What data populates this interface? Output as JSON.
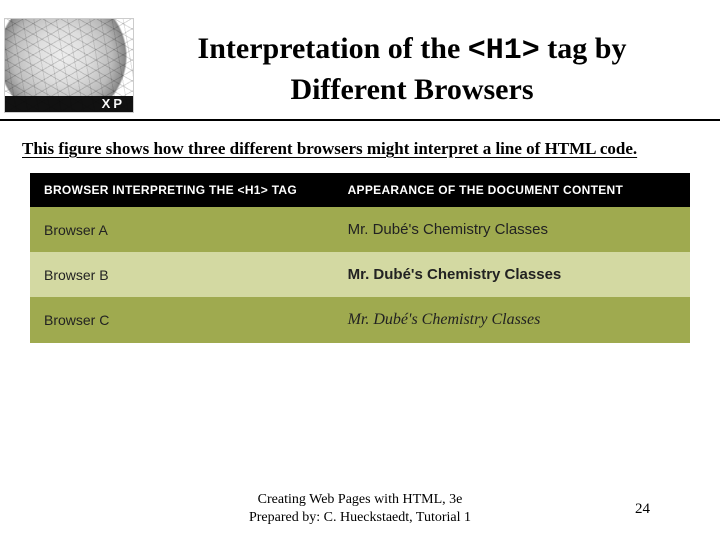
{
  "logo": {
    "band_text": "XP"
  },
  "title": {
    "part1": "Interpretation of the ",
    "code": "<H1>",
    "part2": " tag by",
    "line2": "Different Browsers"
  },
  "caption": "This figure shows how three different browsers might interpret a line of HTML code.",
  "table": {
    "header": {
      "col1": "BROWSER INTERPRETING THE <H1> TAG",
      "col2": "APPEARANCE OF THE DOCUMENT CONTENT"
    },
    "rows": [
      {
        "browser": "Browser A",
        "appearance": "Mr. Dubé's Chemistry Classes"
      },
      {
        "browser": "Browser B",
        "appearance": "Mr. Dubé's Chemistry Classes"
      },
      {
        "browser": "Browser C",
        "appearance": "Mr. Dubé's Chemistry Classes"
      }
    ]
  },
  "footer": {
    "line1": "Creating Web Pages with HTML, 3e",
    "line2": "Prepared by: C. Hueckstaedt, Tutorial 1",
    "page": "24"
  }
}
